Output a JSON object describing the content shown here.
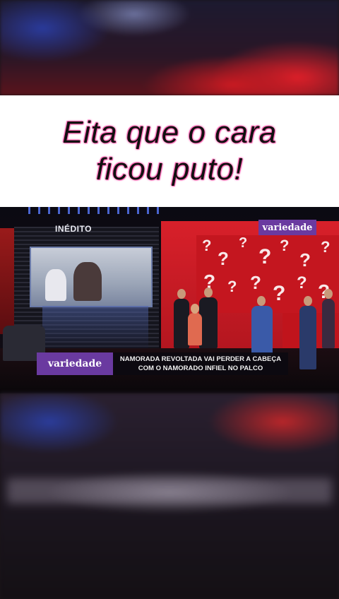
{
  "caption": {
    "line1": "Eita que o cara",
    "line2": "ficou puto!"
  },
  "video": {
    "badge": "INÉDITO",
    "watermark": "variedade",
    "lower_third": {
      "brand": "variedade",
      "line1": "NAMORADA REVOLTADA VAI PERDER A CABEÇA",
      "line2": "COM O NAMORADO INFIEL NO PALCO"
    }
  },
  "colors": {
    "brand_purple": "#6a3aa0",
    "stage_red": "#c4161f",
    "caption_glow": "#ff5fb0"
  }
}
